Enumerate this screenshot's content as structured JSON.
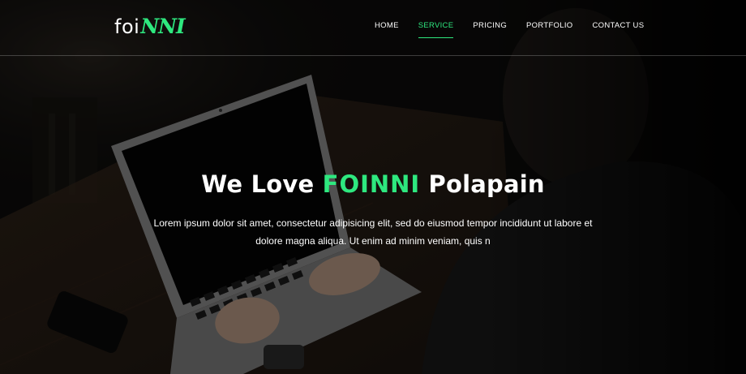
{
  "header": {
    "logo": {
      "part_a": "foi",
      "part_b": "NNI"
    },
    "nav": [
      {
        "label": "HOME",
        "active": false
      },
      {
        "label": "SERVICE",
        "active": true
      },
      {
        "label": "PRICING",
        "active": false
      },
      {
        "label": "PORTFOLIO",
        "active": false
      },
      {
        "label": "CONTACT US",
        "active": false
      }
    ]
  },
  "hero": {
    "title_before": "We Love",
    "title_accent": "FOINNI",
    "title_after": "Polapain",
    "description": "Lorem ipsum dolor sit amet, consectetur adipisicing elit, sed do eiusmod tempor incididunt ut labore et dolore magna aliqua. Ut enim ad minim veniam, quis n"
  },
  "colors": {
    "accent": "#2ee87f",
    "text": "#ffffff",
    "overlay": "#0b0b0b"
  }
}
